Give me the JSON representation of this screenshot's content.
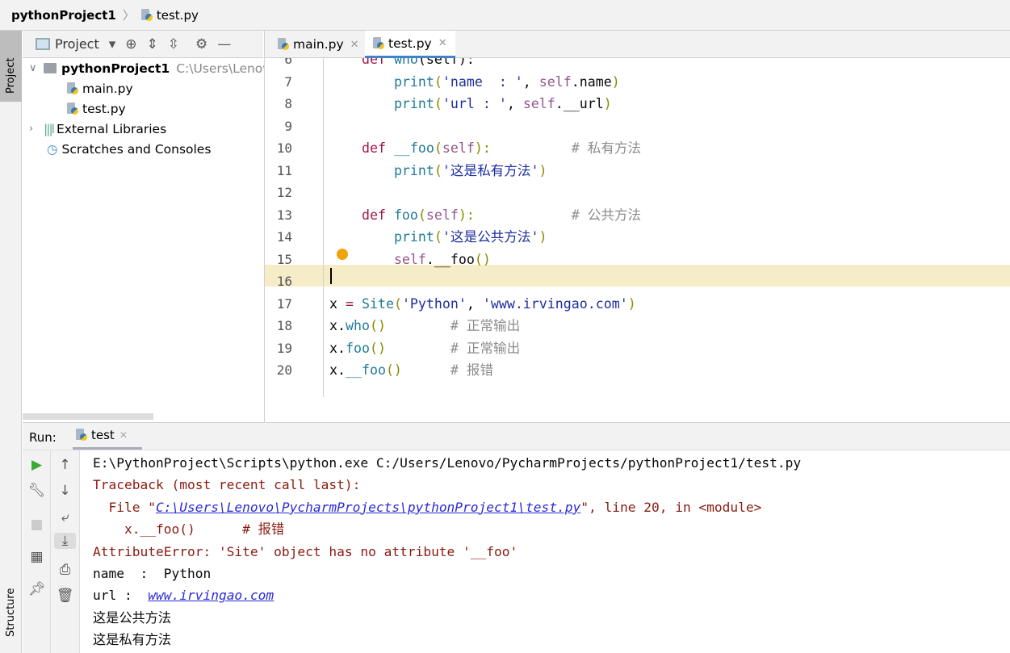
{
  "breadcrumb": {
    "project": "pythonProject1",
    "file": "test.py"
  },
  "left_stripe": {
    "project": "Project",
    "structure": "Structure"
  },
  "project_panel": {
    "title": "Project",
    "icons": [
      "locate-icon",
      "expand-all-icon",
      "collapse-all-icon",
      "gear-icon",
      "minimize-icon"
    ],
    "tree": [
      {
        "label": "pythonProject1",
        "path": "C:\\Users\\Lenovo"
      },
      {
        "label": "main.py"
      },
      {
        "label": "test.py"
      },
      {
        "label": "External Libraries"
      },
      {
        "label": "Scratches and Consoles"
      }
    ]
  },
  "editor": {
    "tabs": [
      {
        "label": "main.py",
        "active": false
      },
      {
        "label": "test.py",
        "active": true
      }
    ],
    "current_line": 16,
    "lines": [
      {
        "n": "6",
        "t": [
          [
            "    ",
            "pl"
          ],
          [
            "def ",
            "kw"
          ],
          [
            "who",
            "fn"
          ],
          [
            "(self):",
            "pl"
          ]
        ]
      },
      {
        "n": "7",
        "t": [
          [
            "        ",
            "pl"
          ],
          [
            "print",
            "fn"
          ],
          [
            "(",
            "br"
          ],
          [
            "'name  : '",
            "st"
          ],
          [
            ", ",
            "pl"
          ],
          [
            "self",
            "sf"
          ],
          [
            ".name",
            "pl"
          ],
          [
            ")",
            "br"
          ]
        ]
      },
      {
        "n": "8",
        "t": [
          [
            "        ",
            "pl"
          ],
          [
            "print",
            "fn"
          ],
          [
            "(",
            "br"
          ],
          [
            "'url : '",
            "st"
          ],
          [
            ", ",
            "pl"
          ],
          [
            "self",
            "sf"
          ],
          [
            ".__url",
            "pl"
          ],
          [
            ")",
            "br"
          ]
        ]
      },
      {
        "n": "9",
        "t": []
      },
      {
        "n": "10",
        "t": [
          [
            "    ",
            "pl"
          ],
          [
            "def ",
            "kw"
          ],
          [
            "__foo",
            "fn"
          ],
          [
            "(",
            "br"
          ],
          [
            "self",
            "sf"
          ],
          [
            "):",
            "br"
          ],
          [
            "          # 私有方法",
            "cm"
          ]
        ]
      },
      {
        "n": "11",
        "t": [
          [
            "        ",
            "pl"
          ],
          [
            "print",
            "fn"
          ],
          [
            "(",
            "br"
          ],
          [
            "'这是私有方法'",
            "st"
          ],
          [
            ")",
            "br"
          ]
        ]
      },
      {
        "n": "12",
        "t": []
      },
      {
        "n": "13",
        "t": [
          [
            "    ",
            "pl"
          ],
          [
            "def ",
            "kw"
          ],
          [
            "foo",
            "fn"
          ],
          [
            "(",
            "br"
          ],
          [
            "self",
            "sf"
          ],
          [
            "):",
            "br"
          ],
          [
            "            # 公共方法",
            "cm"
          ]
        ]
      },
      {
        "n": "14",
        "t": [
          [
            "        ",
            "pl"
          ],
          [
            "print",
            "fn"
          ],
          [
            "(",
            "br"
          ],
          [
            "'这是公共方法'",
            "st"
          ],
          [
            ")",
            "br"
          ]
        ]
      },
      {
        "n": "15",
        "t": [
          [
            "        ",
            "pl"
          ],
          [
            "self",
            "sf"
          ],
          [
            ".__foo",
            "pl"
          ],
          [
            "()",
            "br"
          ]
        ]
      },
      {
        "n": "16",
        "t": []
      },
      {
        "n": "17",
        "t": [
          [
            "x ",
            "pl"
          ],
          [
            "= ",
            "kw"
          ],
          [
            "Site",
            "fn"
          ],
          [
            "(",
            "br"
          ],
          [
            "'Python'",
            "st"
          ],
          [
            ", ",
            "pl"
          ],
          [
            "'www.irvingao.com'",
            "st"
          ],
          [
            ")",
            "br"
          ]
        ]
      },
      {
        "n": "18",
        "t": [
          [
            "x.",
            "pl"
          ],
          [
            "who",
            "fn"
          ],
          [
            "()",
            "br"
          ],
          [
            "        # 正常输出",
            "cm"
          ]
        ]
      },
      {
        "n": "19",
        "t": [
          [
            "x.",
            "pl"
          ],
          [
            "foo",
            "fn"
          ],
          [
            "()",
            "br"
          ],
          [
            "        # 正常输出",
            "cm"
          ]
        ]
      },
      {
        "n": "20",
        "t": [
          [
            "x.",
            "pl"
          ],
          [
            "__foo",
            "fn"
          ],
          [
            "()",
            "br"
          ],
          [
            "      # 报错",
            "cm"
          ]
        ]
      }
    ]
  },
  "run": {
    "label": "Run:",
    "tab": "test",
    "console": [
      {
        "parts": [
          [
            "E:\\PythonProject\\Scripts\\python.exe C:/Users/Lenovo/PycharmProjects/pythonProject1/test.py",
            "pl"
          ]
        ]
      },
      {
        "parts": [
          [
            "Traceback (most recent call last):",
            "err"
          ]
        ]
      },
      {
        "parts": [
          [
            "  File \"",
            "err"
          ],
          [
            "C:\\Users\\Lenovo\\PycharmProjects\\pythonProject1\\test.py",
            "lnk"
          ],
          [
            "\", line 20, in <module>",
            "err"
          ]
        ]
      },
      {
        "parts": [
          [
            "    x.__foo()      # 报错",
            "err"
          ]
        ]
      },
      {
        "parts": [
          [
            "AttributeError: 'Site' object has no attribute '__foo'",
            "err"
          ]
        ]
      },
      {
        "parts": [
          [
            "name  :  Python",
            "pl"
          ]
        ]
      },
      {
        "parts": [
          [
            "url :  ",
            "pl"
          ],
          [
            "www.irvingao.com",
            "lnk"
          ]
        ]
      },
      {
        "parts": [
          [
            "这是公共方法",
            "pl"
          ]
        ]
      },
      {
        "parts": [
          [
            "这是私有方法",
            "pl"
          ]
        ]
      }
    ]
  },
  "colors": {
    "current_line": "#f7ecc8",
    "keyword": "#a0174a",
    "string": "#1d2e9e",
    "error": "#8b1a10",
    "link": "#2a2ad8",
    "accent": "#4083c9",
    "run_green": "#3aaa35"
  }
}
